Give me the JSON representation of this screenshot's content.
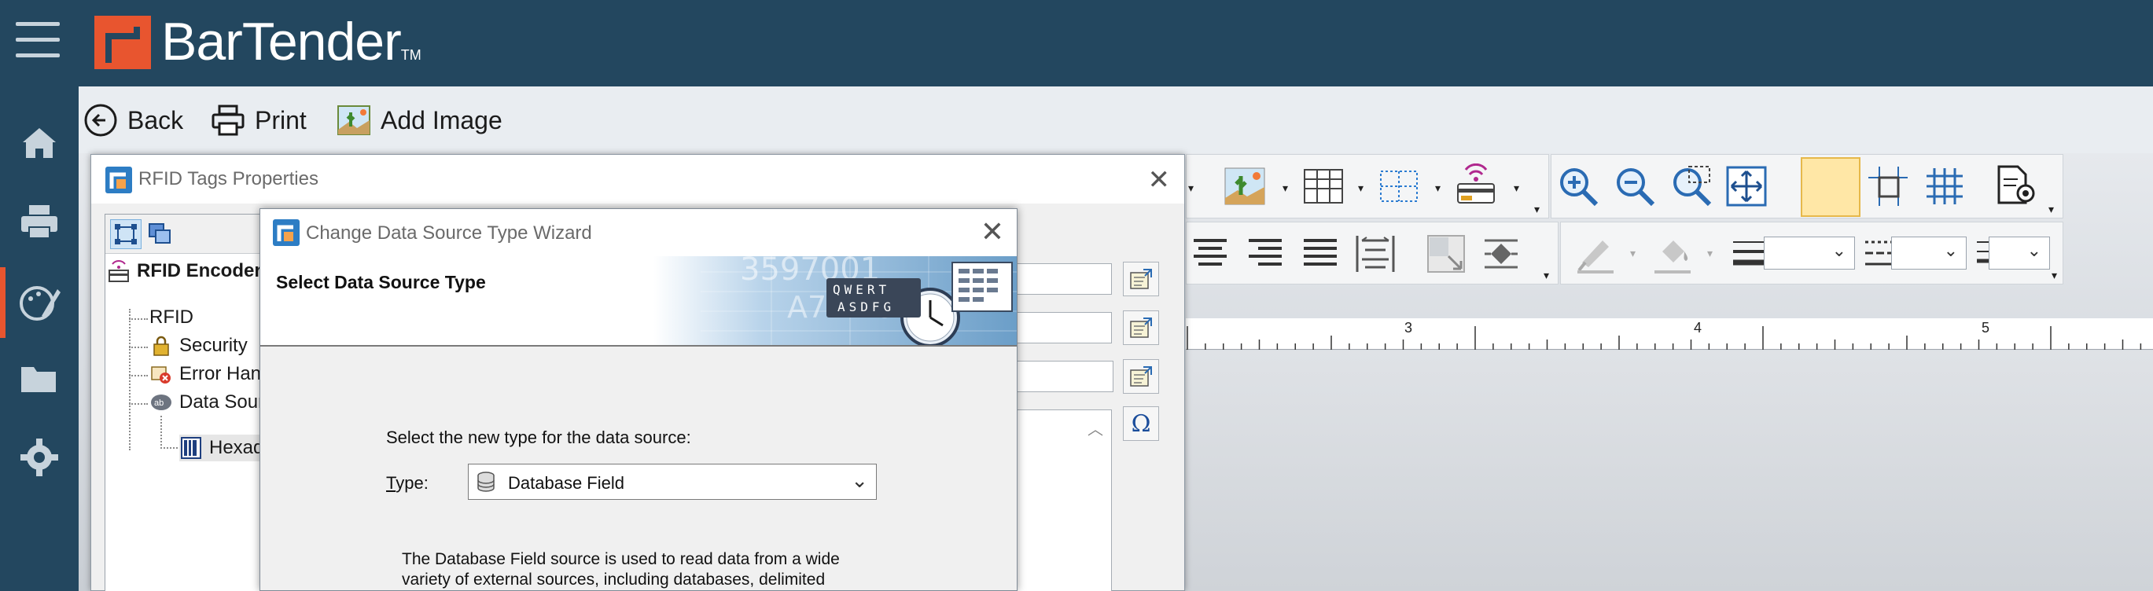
{
  "app": {
    "brand": "BarTender",
    "trademark": "TM"
  },
  "workbar": {
    "back_label": "Back",
    "print_label": "Print",
    "add_image_label": "Add Image"
  },
  "sidebar": {
    "items": [
      {
        "icon": "home-icon"
      },
      {
        "icon": "printer-icon"
      },
      {
        "icon": "design-icon",
        "active": true
      },
      {
        "icon": "folder-icon"
      },
      {
        "icon": "gear-icon"
      }
    ]
  },
  "ruler": {
    "labels": [
      "3",
      "4",
      "5"
    ]
  },
  "rfid_dialog": {
    "title": "RFID Tags Properties",
    "tree": {
      "root": "RFID Encoder",
      "items": [
        "RFID",
        "Security",
        "Error Hand",
        "Data Sourc",
        "Hexade"
      ]
    }
  },
  "wizard": {
    "title": "Change Data Source Type Wizard",
    "heading": "Select Data Source Type",
    "banner_text_1": "3597001",
    "banner_text_2": "A7-118",
    "keys_row1": "QWERT",
    "keys_row2": "ASDFG",
    "instruction": "Select the new type for the data source:",
    "type_label_first": "T",
    "type_label_rest": "ype:",
    "type_value": "Database Field",
    "description": "The Database Field source is used to read data from a wide variety of external sources, including databases, delimited"
  },
  "colors": {
    "header_bg": "#23475f",
    "accent": "#e8552f"
  }
}
